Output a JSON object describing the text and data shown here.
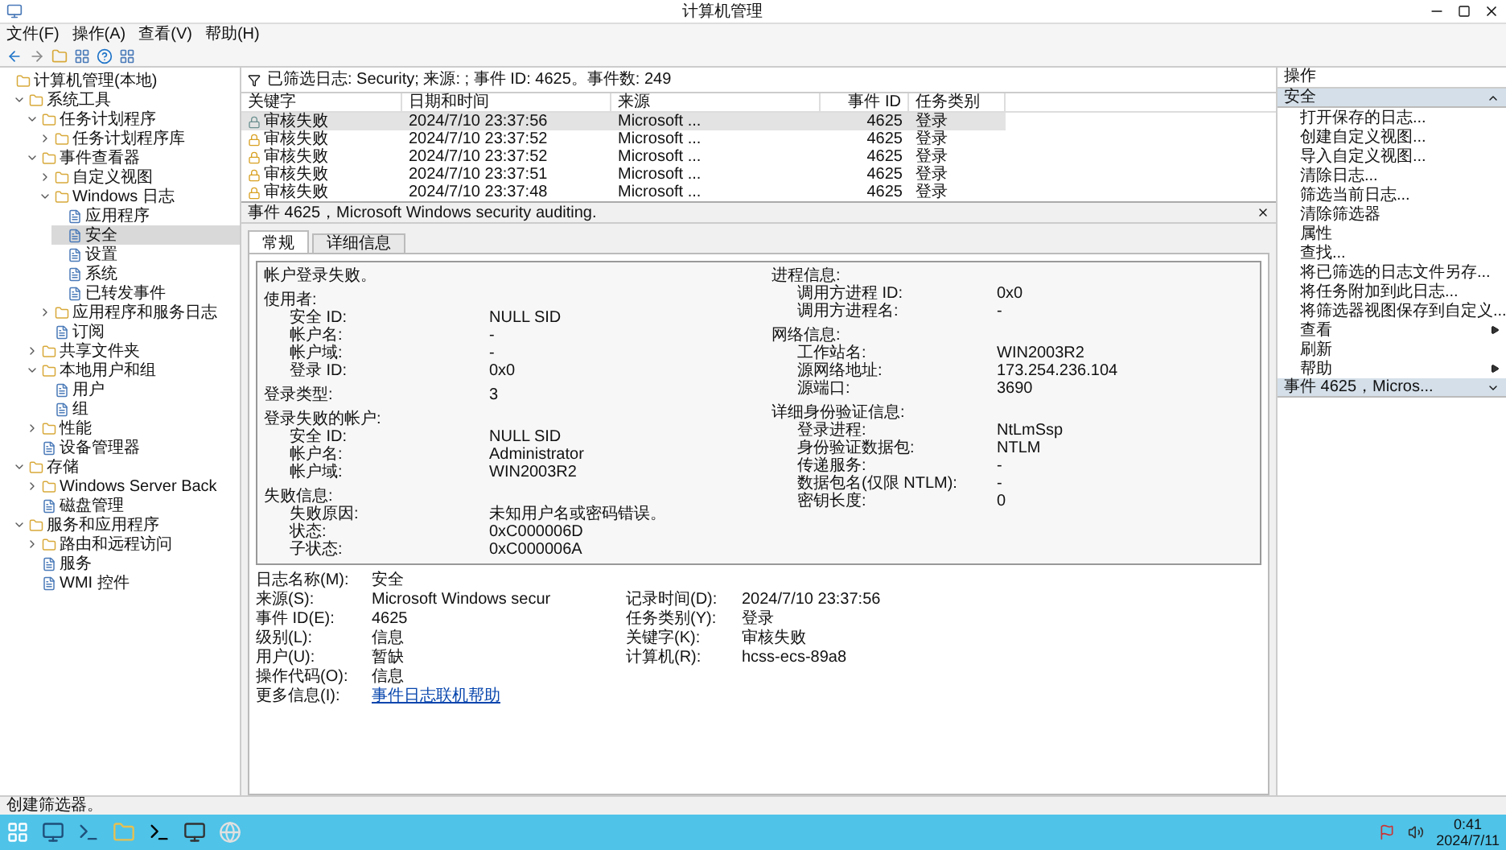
{
  "window": {
    "title": "计算机管理"
  },
  "menu": [
    "文件(F)",
    "操作(A)",
    "查看(V)",
    "帮助(H)"
  ],
  "tree": [
    {
      "label": "计算机管理(本地)",
      "selected": false,
      "children": [
        {
          "label": "系统工具",
          "selected": false,
          "expanded": true,
          "children": [
            {
              "label": "任务计划程序",
              "selected": false,
              "expanded": true,
              "children": [
                {
                  "label": "任务计划程序库",
                  "selected": false,
                  "expanded": false
                }
              ]
            },
            {
              "label": "事件查看器",
              "selected": false,
              "expanded": true,
              "children": [
                {
                  "label": "自定义视图",
                  "selected": false,
                  "expanded": false
                },
                {
                  "label": "Windows 日志",
                  "selected": false,
                  "expanded": true,
                  "children": [
                    {
                      "label": "应用程序",
                      "selected": false
                    },
                    {
                      "label": "安全",
                      "selected": true
                    },
                    {
                      "label": "设置",
                      "selected": false
                    },
                    {
                      "label": "系统",
                      "selected": false
                    },
                    {
                      "label": "已转发事件",
                      "selected": false
                    }
                  ]
                },
                {
                  "label": "应用程序和服务日志",
                  "selected": false,
                  "expanded": false
                },
                {
                  "label": "订阅",
                  "selected": false
                }
              ]
            },
            {
              "label": "共享文件夹",
              "selected": false,
              "expanded": false
            },
            {
              "label": "本地用户和组",
              "selected": false,
              "expanded": true,
              "children": [
                {
                  "label": "用户",
                  "selected": false
                },
                {
                  "label": "组",
                  "selected": false
                }
              ]
            },
            {
              "label": "性能",
              "selected": false,
              "expanded": false
            },
            {
              "label": "设备管理器",
              "selected": false
            }
          ]
        },
        {
          "label": "存储",
          "selected": false,
          "expanded": true,
          "children": [
            {
              "label": "Windows Server Back",
              "selected": false,
              "expanded": false
            },
            {
              "label": "磁盘管理",
              "selected": false
            }
          ]
        },
        {
          "label": "服务和应用程序",
          "selected": false,
          "expanded": true,
          "children": [
            {
              "label": "路由和远程访问",
              "selected": false,
              "expanded": false
            },
            {
              "label": "服务",
              "selected": false
            },
            {
              "label": "WMI 控件",
              "selected": false
            }
          ]
        }
      ]
    }
  ],
  "filter_bar": "已筛选日志: Security; 来源: ; 事件 ID: 4625。事件数: 249",
  "table": {
    "columns": [
      "关键字",
      "日期和时间",
      "来源",
      "事件 ID",
      "任务类别"
    ],
    "rows": [
      {
        "selected": true,
        "cells": [
          "审核失败",
          "2024/7/10 23:37:56",
          "Microsoft ...",
          "4625",
          "登录"
        ]
      },
      {
        "selected": false,
        "cells": [
          "审核失败",
          "2024/7/10 23:37:52",
          "Microsoft ...",
          "4625",
          "登录"
        ]
      },
      {
        "selected": false,
        "cells": [
          "审核失败",
          "2024/7/10 23:37:52",
          "Microsoft ...",
          "4625",
          "登录"
        ]
      },
      {
        "selected": false,
        "cells": [
          "审核失败",
          "2024/7/10 23:37:51",
          "Microsoft ...",
          "4625",
          "登录"
        ]
      },
      {
        "selected": false,
        "cells": [
          "审核失败",
          "2024/7/10 23:37:48",
          "Microsoft ...",
          "4625",
          "登录"
        ]
      }
    ]
  },
  "detail": {
    "title": "事件 4625，Microsoft Windows security auditing.",
    "tabs": [
      {
        "label": "常规",
        "selected": true
      },
      {
        "label": "详细信息",
        "selected": false
      }
    ],
    "message": {
      "intro": "帐户登录失败。",
      "sections": [
        {
          "heading": "使用者:",
          "fields": [
            {
              "label": "安全 ID:",
              "value": "NULL SID"
            },
            {
              "label": "帐户名:",
              "value": "-"
            },
            {
              "label": "帐户域:",
              "value": "-"
            },
            {
              "label": "登录 ID:",
              "value": "0x0"
            }
          ]
        },
        {
          "heading": "登录类型:",
          "value": "3"
        },
        {
          "heading": "登录失败的帐户:",
          "fields": [
            {
              "label": "安全 ID:",
              "value": "NULL SID"
            },
            {
              "label": "帐户名:",
              "value": "Administrator"
            },
            {
              "label": "帐户域:",
              "value": "WIN2003R2"
            }
          ]
        },
        {
          "heading": "失败信息:",
          "fields": [
            {
              "label": "失败原因:",
              "value": "未知用户名或密码错误。"
            },
            {
              "label": "状态:",
              "value": "0xC000006D"
            },
            {
              "label": "子状态:",
              "value": "0xC000006A"
            }
          ]
        },
        {
          "heading": "进程信息:",
          "fields": [
            {
              "label": "调用方进程 ID:",
              "value": "0x0"
            },
            {
              "label": "调用方进程名:",
              "value": "-"
            }
          ]
        },
        {
          "heading": "网络信息:",
          "fields": [
            {
              "label": "工作站名:",
              "value": "WIN2003R2"
            },
            {
              "label": "源网络地址:",
              "value": "173.254.236.104"
            },
            {
              "label": "源端口:",
              "value": "3690"
            }
          ]
        },
        {
          "heading": "详细身份验证信息:",
          "fields": [
            {
              "label": "登录进程:",
              "value": "NtLmSsp"
            },
            {
              "label": "身份验证数据包:",
              "value": "NTLM"
            },
            {
              "label": "传递服务:",
              "value": "-"
            },
            {
              "label": "数据包名(仅限 NTLM):",
              "value": "-"
            },
            {
              "label": "密钥长度:",
              "value": "0"
            }
          ]
        }
      ]
    },
    "properties": [
      [
        {
          "label": "日志名称(M):",
          "value": "安全"
        }
      ],
      [
        {
          "label": "来源(S):",
          "value": "Microsoft Windows secur"
        },
        {
          "label": "记录时间(D):",
          "value": "2024/7/10 23:37:56"
        }
      ],
      [
        {
          "label": "事件 ID(E):",
          "value": "4625"
        },
        {
          "label": "任务类别(Y):",
          "value": "登录"
        }
      ],
      [
        {
          "label": "级别(L):",
          "value": "信息"
        },
        {
          "label": "关键字(K):",
          "value": "审核失败"
        }
      ],
      [
        {
          "label": "用户(U):",
          "value": "暂缺"
        },
        {
          "label": "计算机(R):",
          "value": "hcss-ecs-89a8"
        }
      ],
      [
        {
          "label": "操作代码(O):",
          "value": "信息"
        }
      ],
      [
        {
          "label": "更多信息(I):",
          "value": "事件日志联机帮助",
          "kind": "link"
        }
      ]
    ]
  },
  "actions": {
    "title": "操作",
    "sections": [
      {
        "label": "安全",
        "expanded": true,
        "items": [
          {
            "label": "打开保存的日志...",
            "kind": "action"
          },
          {
            "label": "创建自定义视图...",
            "kind": "action"
          },
          {
            "label": "导入自定义视图...",
            "kind": "action"
          },
          {
            "label": "清除日志...",
            "kind": "action"
          },
          {
            "label": "筛选当前日志...",
            "kind": "action"
          },
          {
            "label": "清除筛选器",
            "kind": "action"
          },
          {
            "label": "属性",
            "kind": "action"
          },
          {
            "label": "查找...",
            "kind": "action"
          },
          {
            "label": "将已筛选的日志文件另存...",
            "kind": "action"
          },
          {
            "label": "将任务附加到此日志...",
            "kind": "action"
          },
          {
            "label": "将筛选器视图保存到自定义...",
            "kind": "action"
          },
          {
            "label": "查看",
            "kind": "submenu"
          },
          {
            "label": "刷新",
            "kind": "action"
          },
          {
            "label": "帮助",
            "kind": "submenu"
          }
        ]
      },
      {
        "label": "事件 4625，Micros...",
        "expanded": false
      }
    ]
  },
  "status_bar": "创建筛选器。",
  "taskbar": {
    "time": "0:41",
    "date": "2024/7/11"
  }
}
